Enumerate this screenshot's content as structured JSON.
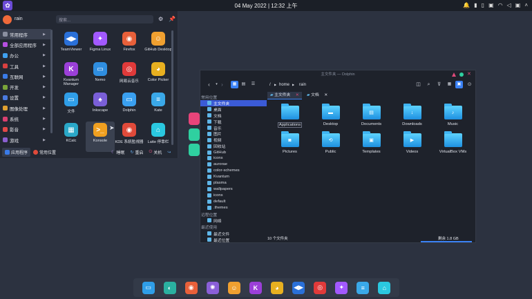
{
  "topbar": {
    "logo": "✿",
    "datetime": "04 May 2022 | 12:32 上午"
  },
  "launcher": {
    "user": "rain",
    "search_placeholder": "搜索...",
    "categories": [
      {
        "label": "常用程序",
        "color": "#8a8fa0"
      },
      {
        "label": "全部应用程序",
        "color": "#b54fe0"
      },
      {
        "label": "办公",
        "color": "#3fa0f0"
      },
      {
        "label": "工具",
        "color": "#d84040"
      },
      {
        "label": "互联网",
        "color": "#3a7be8"
      },
      {
        "label": "开发",
        "color": "#7aa43a"
      },
      {
        "label": "设置",
        "color": "#4a7ae0"
      },
      {
        "label": "图像处理",
        "color": "#e0a030"
      },
      {
        "label": "系统",
        "color": "#d84070"
      },
      {
        "label": "影音",
        "color": "#e04848"
      },
      {
        "label": "游戏",
        "color": "#8a5fd0"
      }
    ],
    "apps": [
      {
        "label": "TeamViewer",
        "icon": "◀▶",
        "color": "#2a70d8"
      },
      {
        "label": "Figma Linux",
        "icon": "✦",
        "color": "#a259ff"
      },
      {
        "label": "Firefox",
        "icon": "◉",
        "color": "#e8603a"
      },
      {
        "label": "GitHub Desktop",
        "icon": "☺",
        "color": "#f0a030"
      },
      {
        "label": "Kvantum Manager",
        "icon": "K",
        "color": "#9b3fd8"
      },
      {
        "label": "Nemo",
        "icon": "▭",
        "color": "#2f8ee0"
      },
      {
        "label": "网易云音乐",
        "icon": "◎",
        "color": "#e03a3a"
      },
      {
        "label": "Color Picker",
        "icon": "◕",
        "color": "#e8b020"
      },
      {
        "label": "文件",
        "icon": "▭",
        "color": "#2f9ee8"
      },
      {
        "label": "Inkscape",
        "icon": "♠",
        "color": "#7a5fd8"
      },
      {
        "label": "Dolphin",
        "icon": "▭",
        "color": "#3aa0f0"
      },
      {
        "label": "Kate",
        "icon": "≡",
        "color": "#3aa8e8"
      },
      {
        "label": "KCalc",
        "icon": "▦",
        "color": "#2aa8c8"
      },
      {
        "label": "Konsole",
        "icon": ">_",
        "color": "#f0a020"
      },
      {
        "label": "KDE 系統監視器",
        "icon": "◉",
        "color": "#e04a3a"
      },
      {
        "label": "Latte 停靠栏",
        "icon": "⌂",
        "color": "#2ac8e0"
      }
    ],
    "footer": {
      "apps": "应用程序",
      "places": "常用位置",
      "sleep": "睡眠",
      "restart": "重启",
      "shutdown": "关机"
    }
  },
  "dolphin": {
    "title": "主文件夹 — Dolphin",
    "breadcrumb": [
      "/",
      "home",
      "rain"
    ],
    "places_header": "常用位置",
    "places": [
      "主文件夹",
      "桌面",
      "文档",
      "下载",
      "音乐",
      "图片",
      "视频",
      "回收站",
      "GitHub",
      "icons",
      "aurorae",
      "color-schemes",
      "Kvantum",
      "plasma",
      "wallpapers",
      "icons",
      "default",
      ".themes"
    ],
    "remote_header": "远程位置",
    "remote": [
      "网络"
    ],
    "recent_header": "最近使用",
    "recent": [
      "最近文件",
      "最近位置"
    ],
    "tabs": [
      "主文件夹",
      "文档"
    ],
    "files": [
      {
        "label": "Applications",
        "glyph": ""
      },
      {
        "label": "Desktop",
        "glyph": "▬"
      },
      {
        "label": "Documents",
        "glyph": "▤"
      },
      {
        "label": "Downloads",
        "glyph": "↓"
      },
      {
        "label": "Music",
        "glyph": "♪"
      },
      {
        "label": "Pictures",
        "glyph": "◙"
      },
      {
        "label": "Public",
        "glyph": "⟲"
      },
      {
        "label": "Templates",
        "glyph": "▣"
      },
      {
        "label": "Videos",
        "glyph": "▶"
      },
      {
        "label": "VirtualBox VMs",
        "glyph": ""
      }
    ],
    "status": "10 个文件夹",
    "free": "剩余 1.8 GB"
  },
  "dock": [
    {
      "name": "files-icon",
      "icon": "▭",
      "color": "#2f9ee8"
    },
    {
      "name": "edge-icon",
      "icon": "◐",
      "color": "#2ab0a0"
    },
    {
      "name": "firefox-icon",
      "icon": "◉",
      "color": "#e8603a"
    },
    {
      "name": "puzzle-icon",
      "icon": "✺",
      "color": "#8a5fd8"
    },
    {
      "name": "github-icon",
      "icon": "☺",
      "color": "#f0a030"
    },
    {
      "name": "kvantum-icon",
      "icon": "K",
      "color": "#9b3fd8"
    },
    {
      "name": "colorpicker-icon",
      "icon": "◕",
      "color": "#e8b020"
    },
    {
      "name": "teamviewer-icon",
      "icon": "◀▶",
      "color": "#2a70d8"
    },
    {
      "name": "netease-icon",
      "icon": "◎",
      "color": "#e03a3a"
    },
    {
      "name": "figma-icon",
      "icon": "✦",
      "color": "#a259ff"
    },
    {
      "name": "kate-icon",
      "icon": "≡",
      "color": "#3aa8e8"
    },
    {
      "name": "latte-icon",
      "icon": "⌂",
      "color": "#2ac8e0"
    }
  ]
}
